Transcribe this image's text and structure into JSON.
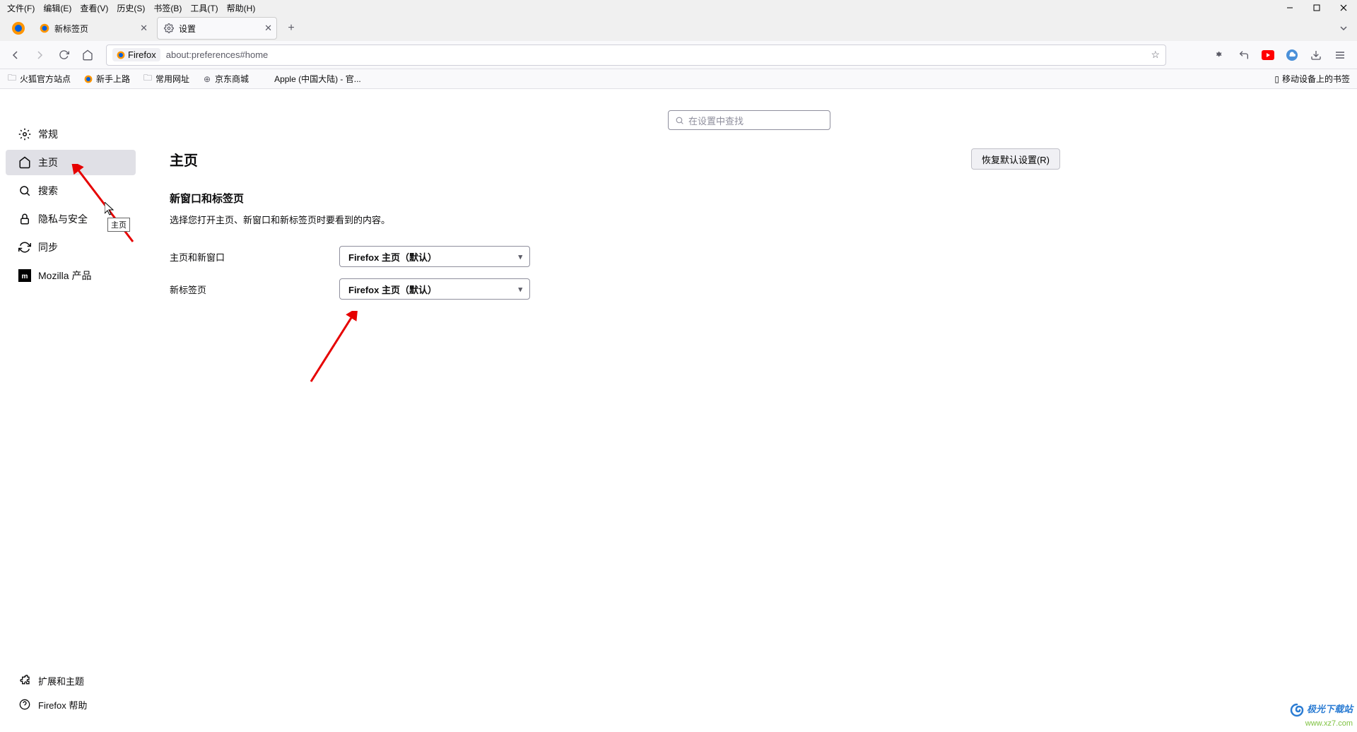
{
  "menubar": [
    "文件(F)",
    "编辑(E)",
    "查看(V)",
    "历史(S)",
    "书签(B)",
    "工具(T)",
    "帮助(H)"
  ],
  "tabs": [
    {
      "title": "新标签页",
      "active": false
    },
    {
      "title": "设置",
      "active": true
    }
  ],
  "urlbar": {
    "badge": "Firefox",
    "url": "about:preferences#home"
  },
  "bookmarks": [
    "火狐官方站点",
    "新手上路",
    "常用网址",
    "京东商城",
    "Apple (中国大陆) - 官..."
  ],
  "mobile_bookmarks": "移动设备上的书签",
  "search_placeholder": "在设置中查找",
  "sidebar": {
    "items": [
      {
        "label": "常规"
      },
      {
        "label": "主页"
      },
      {
        "label": "搜索"
      },
      {
        "label": "隐私与安全"
      },
      {
        "label": "同步"
      },
      {
        "label": "Mozilla 产品"
      }
    ],
    "footer": [
      {
        "label": "扩展和主题"
      },
      {
        "label": "Firefox 帮助"
      }
    ]
  },
  "page": {
    "title": "主页",
    "restore": "恢复默认设置(R)",
    "section_title": "新窗口和标签页",
    "section_desc": "选择您打开主页、新窗口和新标签页时要看到的内容。",
    "row1_label": "主页和新窗口",
    "row1_value": "Firefox 主页（默认）",
    "row2_label": "新标签页",
    "row2_value": "Firefox 主页（默认）"
  },
  "tooltip": "主页",
  "watermark": {
    "line1": "极光下载站",
    "line2": "www.xz7.com"
  }
}
